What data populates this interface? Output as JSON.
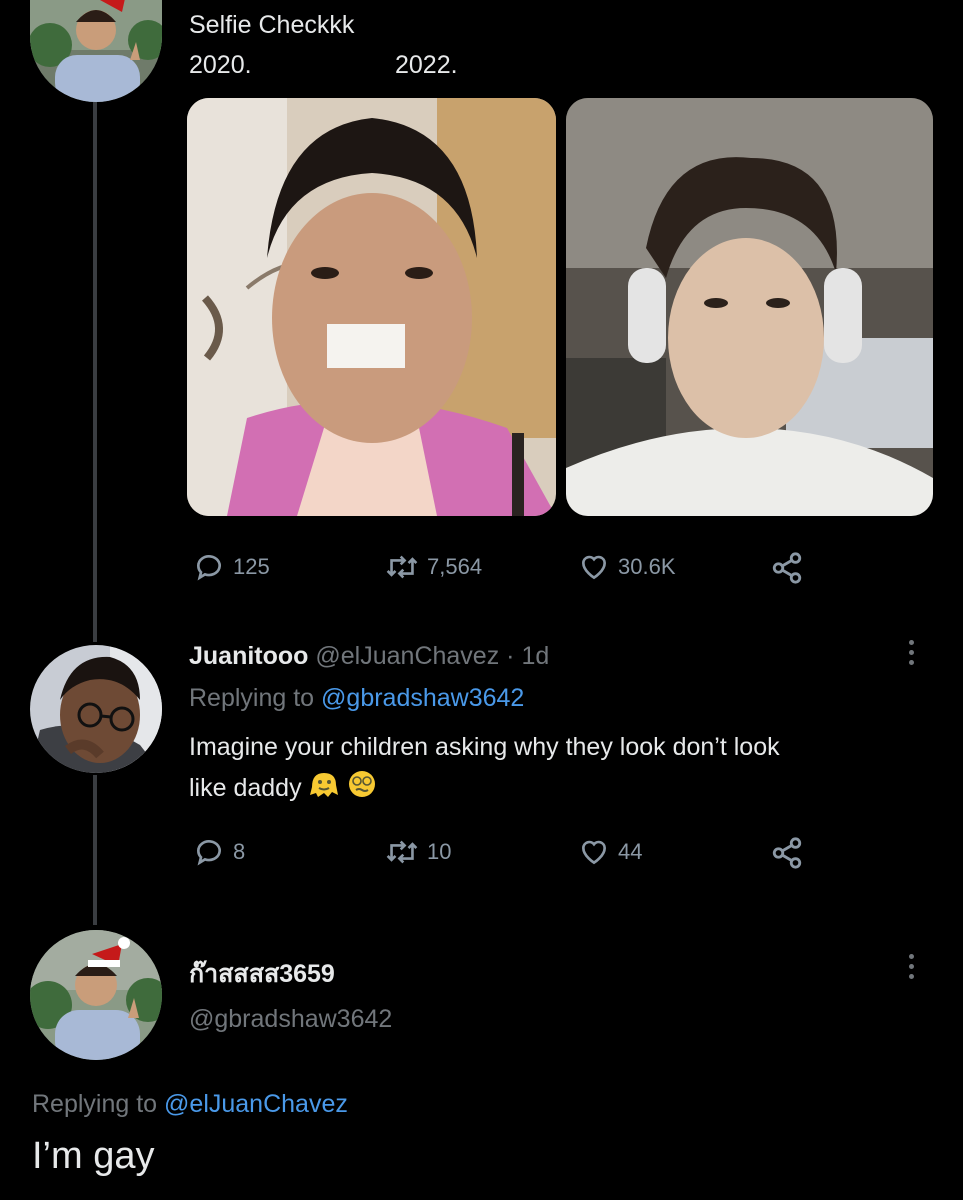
{
  "original_tweet": {
    "text_line1": "Selfie Checkkk",
    "year_left": "2020.",
    "year_right": "2022.",
    "stats": {
      "replies": "125",
      "retweets": "7,564",
      "likes": "30.6K"
    }
  },
  "reply1": {
    "display_name": "Juanitooo",
    "handle": "@elJuanChavez",
    "time": "· 1d",
    "replying_prefix": "Replying to",
    "replying_handle": "@gbradshaw3642",
    "text_line1": "Imagine your children asking why they look don’t look",
    "text_line2": "like daddy",
    "stats": {
      "replies": "8",
      "retweets": "10",
      "likes": "44"
    }
  },
  "reply2": {
    "display_name": "ก๊าสสสส3659",
    "handle": "@gbradshaw3642",
    "replying_prefix": "Replying to",
    "replying_handle": "@elJuanChavez",
    "text": "I’m gay"
  },
  "icons": {
    "reply": "speech-bubble-icon",
    "retweet": "retweet-arrows-icon",
    "like": "heart-icon",
    "share": "share-nodes-icon",
    "more": "vertical-dots-icon"
  },
  "colors": {
    "background": "#000000",
    "link": "#4a99e9",
    "muted": "#71767b",
    "text": "#e7e9ea"
  }
}
